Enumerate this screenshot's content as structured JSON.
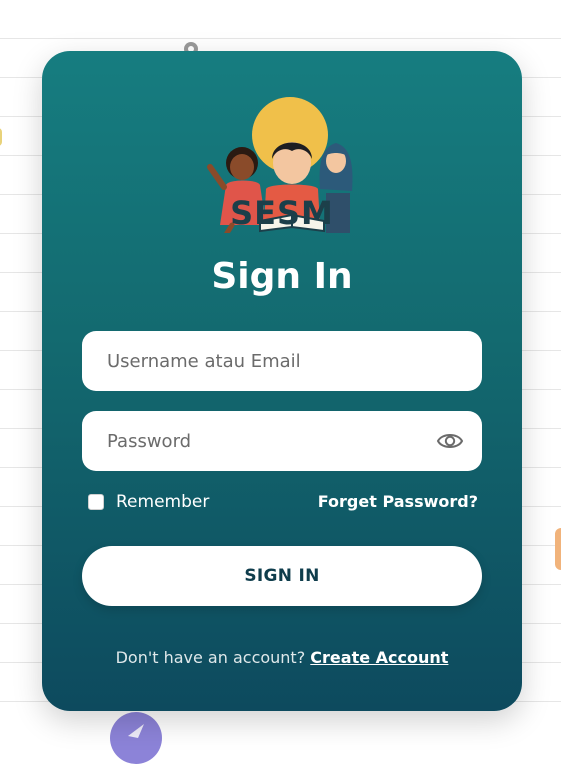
{
  "brand": {
    "logo_text": "SESM"
  },
  "form": {
    "title": "Sign In",
    "username": {
      "placeholder": "Username atau Email",
      "value": ""
    },
    "password": {
      "placeholder": "Password",
      "value": "",
      "visibility_icon": "eye-icon"
    },
    "remember": {
      "label": "Remember",
      "checked": false
    },
    "forget_label": "Forget Password?",
    "submit_label": "SIGN IN",
    "footer": {
      "text": "Don't have an account?",
      "link": "Create Account"
    }
  },
  "colors": {
    "card_top": "#167d80",
    "card_bottom": "#0d4a5e",
    "button_text": "#0f3d4c",
    "logo_text": "#1c3f4a"
  }
}
